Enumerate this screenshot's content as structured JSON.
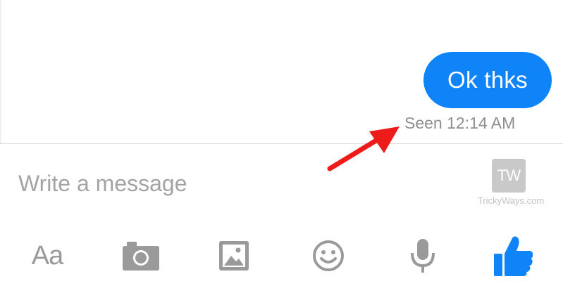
{
  "thread": {
    "message": {
      "text": "Ok thks",
      "bubble_color": "#0f83f8"
    },
    "seen_status": "Seen 12:14 AM",
    "annotation_arrow_color": "#ee1b1b"
  },
  "composer": {
    "placeholder": "Write a message",
    "value": ""
  },
  "watermark": {
    "logo_text": "TW",
    "site_text": "TrickyWays.com"
  },
  "toolbar": {
    "text_style_label": "Aa",
    "icons": [
      "text-style",
      "camera-icon",
      "gallery-icon",
      "emoji-icon",
      "microphone-icon",
      "like-thumb-icon"
    ],
    "like_color": "#0f83f8",
    "icon_color": "#9a9a9a"
  }
}
